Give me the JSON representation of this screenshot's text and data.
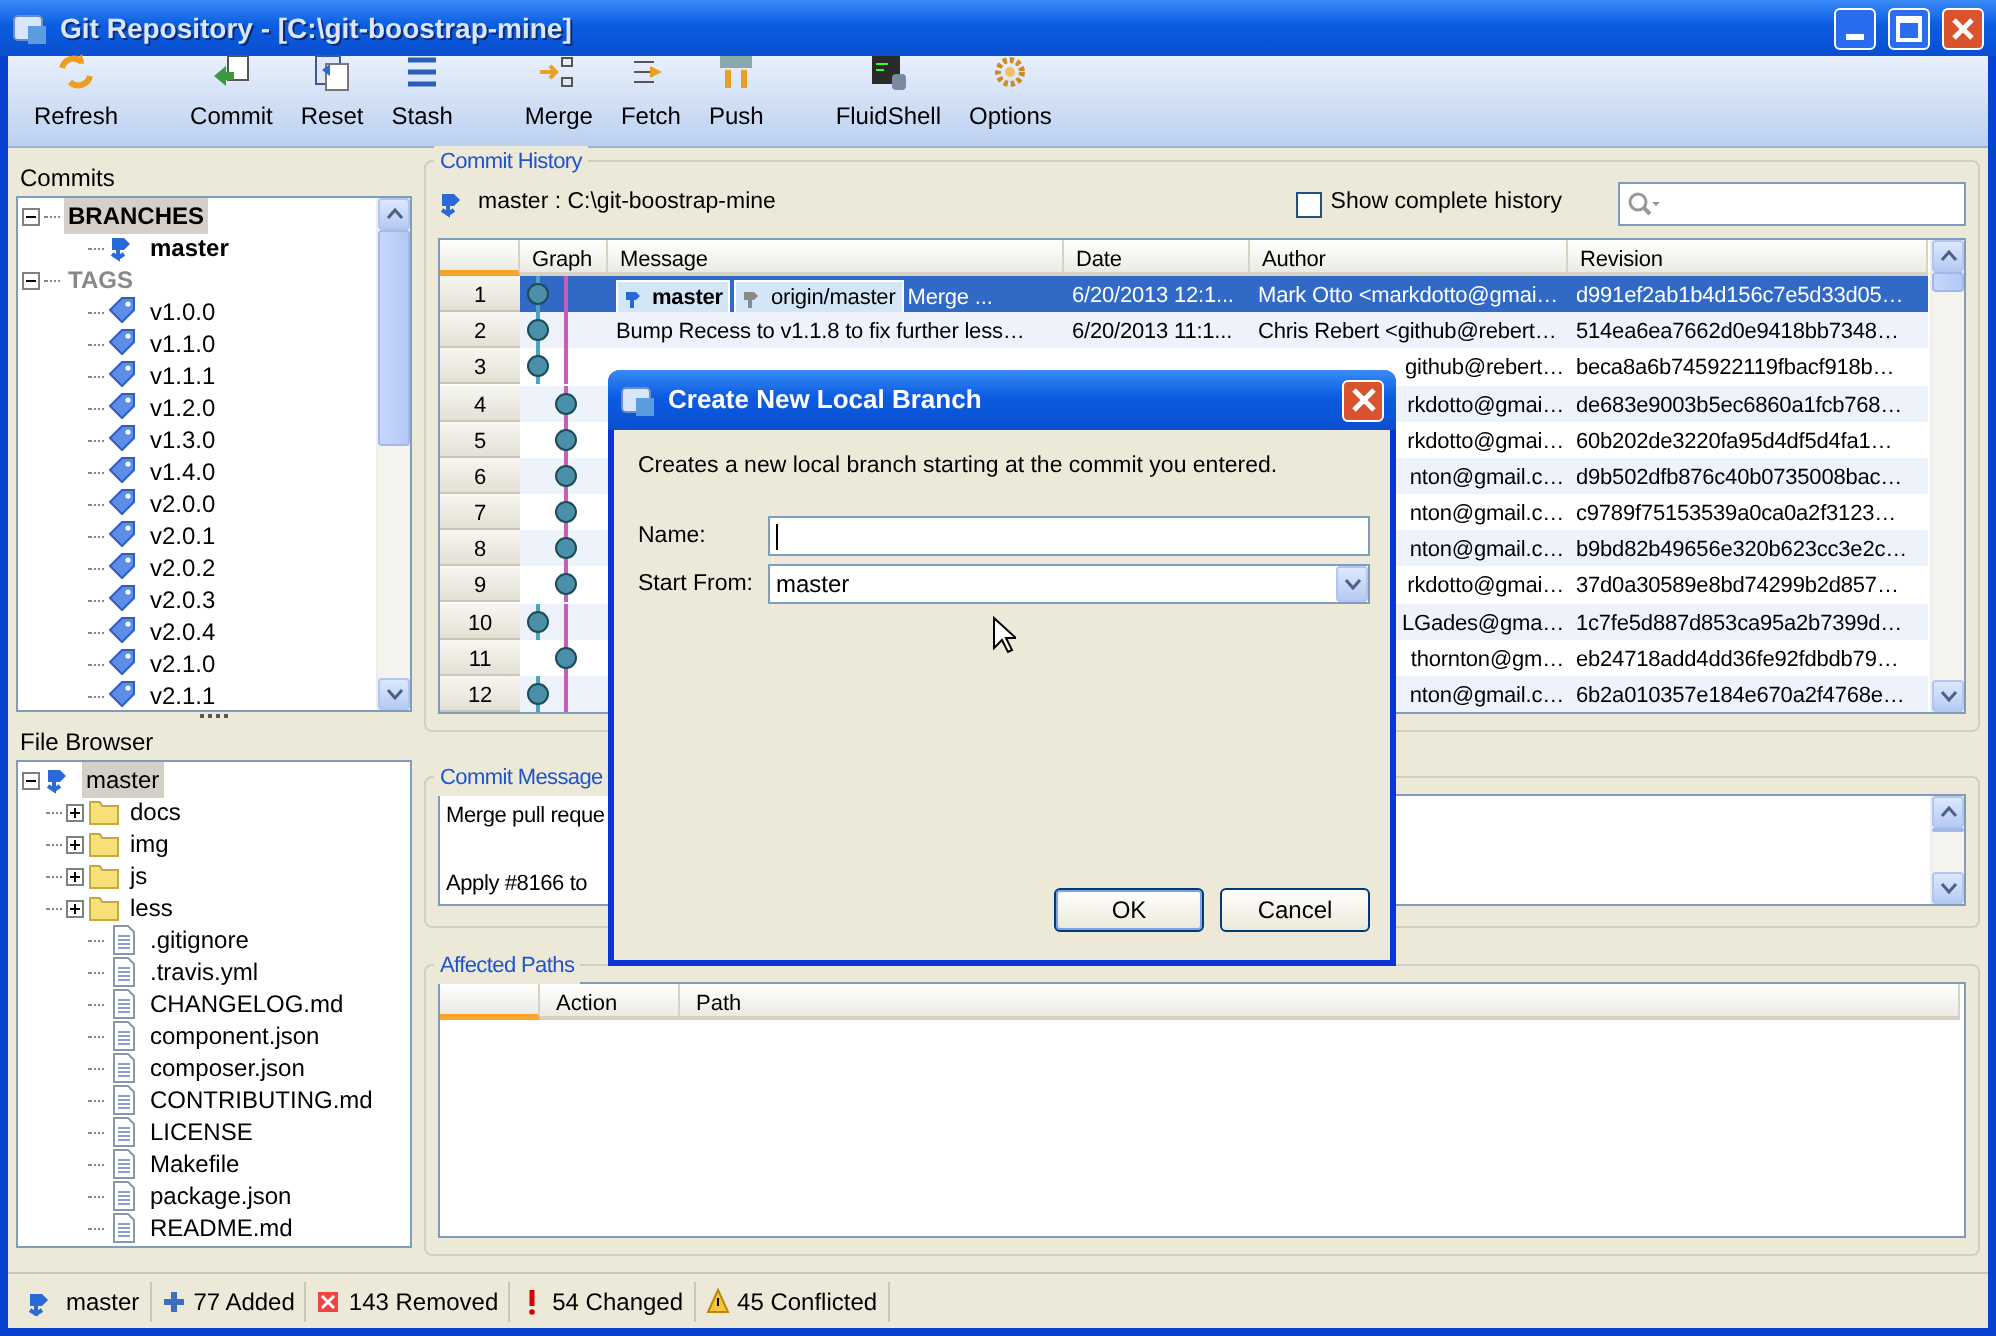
{
  "window": {
    "title": "Git Repository - [C:\\git-boostrap-mine]"
  },
  "toolbar": [
    {
      "label": "Refresh"
    },
    {
      "label": "Commit"
    },
    {
      "label": "Reset"
    },
    {
      "label": "Stash"
    },
    {
      "label": "Merge"
    },
    {
      "label": "Fetch"
    },
    {
      "label": "Push"
    },
    {
      "label": "FluidShell"
    },
    {
      "label": "Options"
    }
  ],
  "commits_panel": {
    "title": "Commits",
    "tree": [
      {
        "label": "BRANCHES",
        "kind": "group",
        "selected": true,
        "expanded": true,
        "children": [
          {
            "label": "master",
            "kind": "branch",
            "current": true
          }
        ]
      },
      {
        "label": "TAGS",
        "kind": "group",
        "selected": false,
        "expanded": true,
        "children": [
          {
            "label": "v1.0.0",
            "kind": "tag"
          },
          {
            "label": "v1.1.0",
            "kind": "tag"
          },
          {
            "label": "v1.1.1",
            "kind": "tag"
          },
          {
            "label": "v1.2.0",
            "kind": "tag"
          },
          {
            "label": "v1.3.0",
            "kind": "tag"
          },
          {
            "label": "v1.4.0",
            "kind": "tag"
          },
          {
            "label": "v2.0.0",
            "kind": "tag"
          },
          {
            "label": "v2.0.1",
            "kind": "tag"
          },
          {
            "label": "v2.0.2",
            "kind": "tag"
          },
          {
            "label": "v2.0.3",
            "kind": "tag"
          },
          {
            "label": "v2.0.4",
            "kind": "tag"
          },
          {
            "label": "v2.1.0",
            "kind": "tag"
          },
          {
            "label": "v2.1.1",
            "kind": "tag"
          }
        ]
      }
    ]
  },
  "file_browser": {
    "title": "File Browser",
    "tree": [
      {
        "label": "master",
        "kind": "branch",
        "selected": true,
        "expanded": true,
        "children": [
          {
            "label": "docs",
            "kind": "folder",
            "expanded": false
          },
          {
            "label": "img",
            "kind": "folder",
            "expanded": false
          },
          {
            "label": "js",
            "kind": "folder",
            "expanded": false
          },
          {
            "label": "less",
            "kind": "folder",
            "expanded": false
          },
          {
            "label": ".gitignore",
            "kind": "file"
          },
          {
            "label": ".travis.yml",
            "kind": "file"
          },
          {
            "label": "CHANGELOG.md",
            "kind": "file"
          },
          {
            "label": "component.json",
            "kind": "file"
          },
          {
            "label": "composer.json",
            "kind": "file"
          },
          {
            "label": "CONTRIBUTING.md",
            "kind": "file"
          },
          {
            "label": "LICENSE",
            "kind": "file"
          },
          {
            "label": "Makefile",
            "kind": "file"
          },
          {
            "label": "package.json",
            "kind": "file"
          },
          {
            "label": "README.md",
            "kind": "file"
          }
        ]
      }
    ]
  },
  "commit_history": {
    "title": "Commit History",
    "branch_path": "master : C:\\git-boostrap-mine",
    "show_complete_history": {
      "label": "Show complete history",
      "checked": false
    },
    "columns": [
      "Graph",
      "Message",
      "Date",
      "Author",
      "Revision"
    ],
    "rows": [
      {
        "num": "1",
        "kind": "main",
        "selected": true,
        "refs": [
          {
            "label": "master",
            "kind": "local"
          },
          {
            "label": "origin/master",
            "kind": "remote"
          }
        ],
        "message": "Merge ...",
        "date": "6/20/2013 12:1...",
        "author": "Mark Otto <markdotto@gmai…",
        "revision": "d991ef2ab1b4d156c7e5d33d05…"
      },
      {
        "num": "2",
        "kind": "main",
        "selected": false,
        "message": "Bump Recess to v1.1.8 to fix further less…",
        "date": "6/20/2013 11:1...",
        "author": "Chris Rebert <github@rebert…",
        "revision": "514ea6ea7662d0e9418bb7348…"
      },
      {
        "num": "3",
        "kind": "main",
        "selected": false,
        "author": "github@rebert…",
        "revision": "beca8a6b745922119fbacf918b…"
      },
      {
        "num": "4",
        "kind": "side",
        "selected": false,
        "author": "rkdotto@gmai…",
        "revision": "de683e9003b5ec6860a1fcb768…"
      },
      {
        "num": "5",
        "kind": "side",
        "selected": false,
        "author": "rkdotto@gmai…",
        "revision": "60b202de3220fa95d4df5d4fa1…"
      },
      {
        "num": "6",
        "kind": "side",
        "selected": false,
        "author": "nton@gmail.c…",
        "revision": "d9b502dfb876c40b0735008bac…"
      },
      {
        "num": "7",
        "kind": "side",
        "selected": false,
        "author": "nton@gmail.c…",
        "revision": "c9789f75153539a0ca0a2f3123…"
      },
      {
        "num": "8",
        "kind": "side",
        "selected": false,
        "author": "nton@gmail.c…",
        "revision": "b9bd82b49656e320b623cc3e2c…"
      },
      {
        "num": "9",
        "kind": "side",
        "selected": false,
        "author": "rkdotto@gmai…",
        "revision": "37d0a30589e8bd74299b2d857…"
      },
      {
        "num": "10",
        "kind": "main",
        "selected": false,
        "author": "LGades@gma…",
        "revision": "1c7fe5d887d853ca95a2b7399d…"
      },
      {
        "num": "11",
        "kind": "side",
        "selected": false,
        "author": "thornton@gm…",
        "revision": "eb24718add4dd36fe92fdbdb79…"
      },
      {
        "num": "12",
        "kind": "main",
        "selected": false,
        "author": "nton@gmail.c…",
        "revision": "6b2a010357e184e670a2f4768e…"
      }
    ]
  },
  "commit_message": {
    "title": "Commit Message",
    "lines": [
      "Merge pull reque",
      "Apply #8166 to"
    ]
  },
  "affected_paths": {
    "title": "Affected Paths",
    "columns": [
      "Action",
      "Path"
    ]
  },
  "status_bar": [
    {
      "label": "master",
      "kind": "branch"
    },
    {
      "label": "77 Added",
      "kind": "added"
    },
    {
      "label": "143 Removed",
      "kind": "removed"
    },
    {
      "label": "54 Changed",
      "kind": "changed"
    },
    {
      "label": "45 Conflicted",
      "kind": "conflicted"
    }
  ],
  "dialog": {
    "title": "Create New Local Branch",
    "description": "Creates a new local branch starting at the commit you entered.",
    "name_label": "Name:",
    "start_label": "Start From:",
    "start_value": "master",
    "buttons": [
      {
        "label": "OK",
        "default": true
      },
      {
        "label": "Cancel",
        "default": false
      }
    ]
  }
}
